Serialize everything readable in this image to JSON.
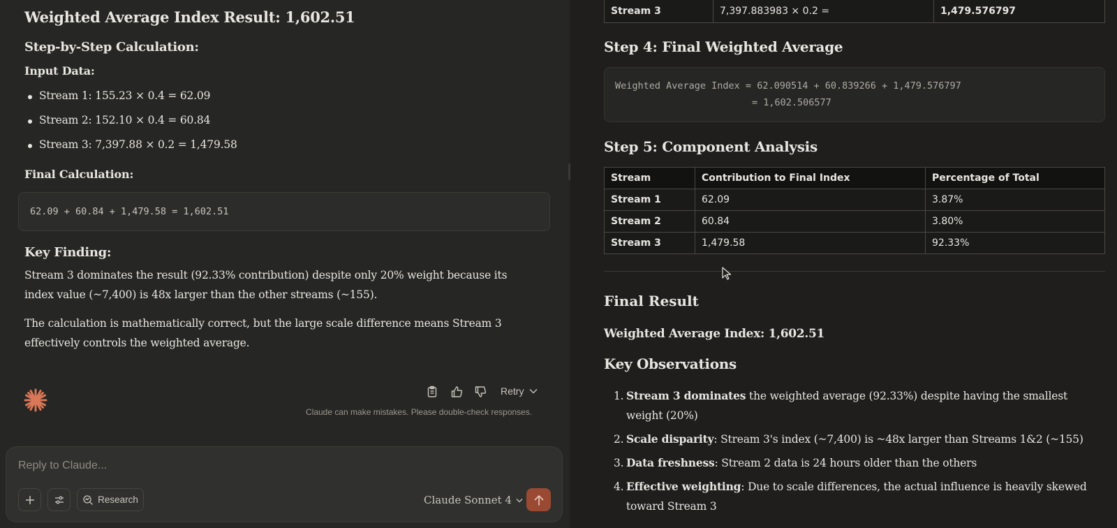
{
  "left": {
    "title": "Weighted Average Index Result: 1,602.51",
    "step_heading": "Step-by-Step Calculation:",
    "input_heading": "Input Data:",
    "inputs": [
      "Stream 1: 155.23 × 0.4 = 62.09",
      "Stream 2: 152.10 × 0.4 = 60.84",
      "Stream 3: 7,397.88 × 0.2 = 1,479.58"
    ],
    "final_heading": "Final Calculation:",
    "final_code": "62.09 + 60.84 + 1,479.58 = 1,602.51",
    "key_heading": "Key Finding:",
    "para1": "Stream 3 dominates the result (92.33% contribution) despite only 20% weight because its index value (~7,400) is 48x larger than the other streams (~155).",
    "para2": "The calculation is mathematically correct, but the large scale difference means Stream 3 effectively controls the weighted average."
  },
  "actions": {
    "copy_icon": "clipboard-icon",
    "like_icon": "thumbs-up-icon",
    "dislike_icon": "thumbs-down-icon",
    "retry_label": "Retry",
    "disclaimer": "Claude can make mistakes. Please double-check responses."
  },
  "composer": {
    "placeholder": "Reply to Claude...",
    "research_label": "Research",
    "model_label": "Claude Sonnet 4",
    "accent": "#9a4a33"
  },
  "right": {
    "top_row": {
      "stream": "Stream 3",
      "formula": "7,397.883983 × 0.2 =",
      "result": "1,479.576797"
    },
    "step4_heading": "Step 4: Final Weighted Average",
    "step4_line1": "Weighted Average Index = 62.090514 + 60.839266 + 1,479.576797",
    "step4_line2": "= 1,602.506577",
    "step5_heading": "Step 5: Component Analysis",
    "comp_headers": [
      "Stream",
      "Contribution to Final Index",
      "Percentage of Total"
    ],
    "comp_rows": [
      [
        "Stream 1",
        "62.09",
        "3.87%"
      ],
      [
        "Stream 2",
        "60.84",
        "3.80%"
      ],
      [
        "Stream 3",
        "1,479.58",
        "92.33%"
      ]
    ],
    "final_heading": "Final Result",
    "weighted_label": "Weighted Average Index: 1,602.51",
    "obs_heading": "Key Observations",
    "observations": [
      {
        "num": "1.",
        "bold": "Stream 3 dominates",
        "text": " the weighted average (92.33%) despite having the smallest weight (20%)"
      },
      {
        "num": "2.",
        "bold": "Scale disparity",
        "text": ": Stream 3's index (~7,400) is ~48x larger than Streams 1&2 (~155)"
      },
      {
        "num": "3.",
        "bold": "Data freshness",
        "text": ": Stream 2 data is 24 hours older than the others"
      },
      {
        "num": "4.",
        "bold": "Effective weighting",
        "text": ": Due to scale differences, the actual influence is heavily skewed toward Stream 3"
      }
    ]
  }
}
